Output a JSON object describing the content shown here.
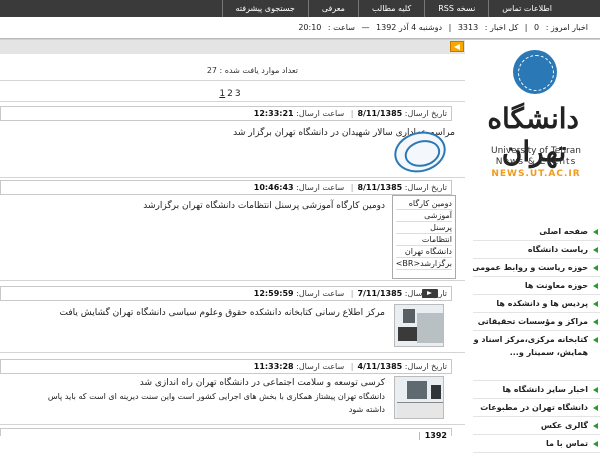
{
  "topnav": {
    "items": [
      "اطلاعات تماس",
      "نسخه RSS",
      "کلیه مطالب",
      "معرفی",
      "جستجوی پیشرفته"
    ]
  },
  "statusbar": {
    "today_label": "اخبار امروز :",
    "today_value": "0",
    "total_label": "کل اخبار :",
    "total_value": "3313",
    "date": "دوشنبه 4 آذر 1392",
    "time_label": "ساعت :",
    "time_value": "20:10"
  },
  "logo": {
    "fa": "دانشگاه تهران",
    "en1": "University of Tehran",
    "en2": "News & Events",
    "url": "NEWS.UT.AC.IR"
  },
  "sidebar": {
    "menu": [
      "صفحه اصلی",
      "ریاست دانشگاه",
      "حوزه ریاست و روابط عمومی",
      "حوزه معاونت ها",
      "پردیس ها و دانشکده ها",
      "مراکز و مؤسسات تحقیقاتی",
      "کتابخانه مرکزی،مرکز اسناد و همایش، سمینار و...",
      "اخبار سایر دانشگاه ها",
      "دانشگاه تهران در مطبوعات",
      "گالری عکس",
      "تماس با ما"
    ]
  },
  "results": {
    "count_label": "تعداد موارد یافت شده :",
    "count_value": "27",
    "pages": [
      "1",
      "2",
      "3"
    ]
  },
  "meta_labels": {
    "date": "تاریخ ارسال:",
    "time": "ساعت ارسال:"
  },
  "items": [
    {
      "date": "8/11/1385",
      "time": "12:33:21",
      "title": "مراسم عزاداری سالار شهیدان در دانشگاه تهران برگزار شد",
      "image": "university-stamp"
    },
    {
      "date": "8/11/1385",
      "time": "10:46:43",
      "title": "دومین کارگاه آموزشی پرسنل انتظامات دانشگاه تهران برگزارشد",
      "broken_text": [
        "دومین کارگاه",
        "آموزشی",
        "پرسنل",
        "انتظامات",
        "دانشگاه تهران",
        "برگزارشد<BR>"
      ]
    },
    {
      "date": "7/11/1385",
      "time": "12:59:59",
      "title": "مرکز اطلاع رسانی کتابخانه دانشکده حقوق وعلوم سیاسی دانشگاه تهران گشایش یافت",
      "image": "library-photo"
    },
    {
      "date": "4/11/1385",
      "time": "11:33:28",
      "title": "کرسی توسعه و سلامت اجتماعی در دانشگاه تهران راه اندازی شد",
      "desc1": "دانشگاه تهران پیشتاز همکاری با بخش های اجرایی کشور است واین سنت دیرینه ای است که باید پاس",
      "desc2": "داشته شود",
      "image": "meeting-photo"
    }
  ],
  "partial_row": {
    "date": "1392",
    "sep": "|"
  }
}
